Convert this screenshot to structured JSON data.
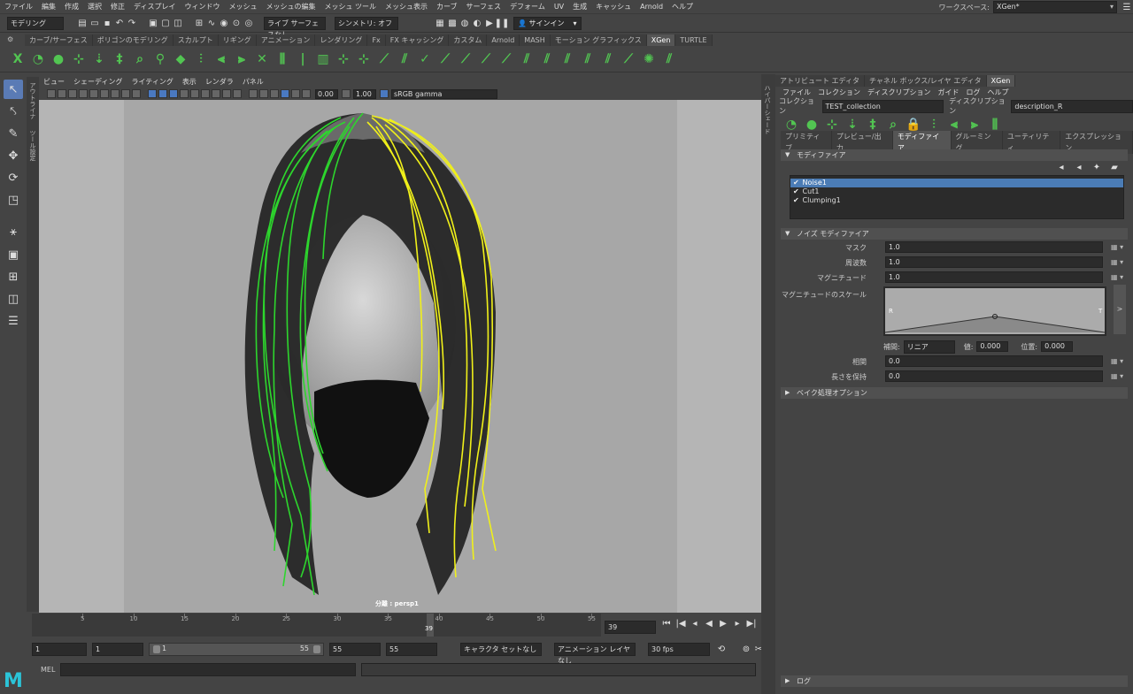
{
  "menubar": {
    "items": [
      "ファイル",
      "編集",
      "作成",
      "選択",
      "修正",
      "ディスプレイ",
      "ウィンドウ",
      "メッシュ",
      "メッシュの編集",
      "メッシュ ツール",
      "メッシュ表示",
      "カーブ",
      "サーフェス",
      "デフォーム",
      "UV",
      "生成",
      "キャッシュ",
      "Arnold",
      "ヘルプ"
    ],
    "workspace_label": "ワークスペース:",
    "workspace_value": "XGen*"
  },
  "status": {
    "mode": "モデリング",
    "live_surface": "ライブ サーフェスなし",
    "symmetry": "シンメトリ: オフ",
    "signin": "サインイン"
  },
  "shelf": {
    "tabs": [
      "カーブ/サーフェス",
      "ポリゴンのモデリング",
      "スカルプト",
      "リギング",
      "アニメーション",
      "レンダリング",
      "Fx",
      "FX キャッシング",
      "カスタム",
      "Arnold",
      "MASH",
      "モーション グラフィックス",
      "XGen",
      "TURTLE"
    ],
    "active": "XGen"
  },
  "toolbox": {
    "side_labels": [
      "アウトライナ",
      "ツール設定"
    ]
  },
  "panel": {
    "menu": [
      "ビュー",
      "シェーディング",
      "ライティング",
      "表示",
      "レンダラ",
      "パネル"
    ],
    "val1": "0.00",
    "val2": "1.00",
    "colorspace": "sRGB gamma",
    "camera": "分離 : persp1"
  },
  "timeline": {
    "ticks": [
      "5",
      "10",
      "15",
      "20",
      "25",
      "30",
      "35",
      "40",
      "45",
      "50",
      "55"
    ],
    "current": "39",
    "current_field": "39"
  },
  "range": {
    "start": "1",
    "start2": "1",
    "slider_start": "1",
    "slider_end": "55",
    "end": "55",
    "end2": "55",
    "char_set": "キャラクタ セットなし",
    "anim_layer": "アニメーション レイヤなし",
    "fps": "30 fps"
  },
  "cmd": {
    "label": "MEL"
  },
  "right": {
    "side_label": "ハイパーシェード",
    "tabs": [
      "アトリビュート エディタ",
      "チャネル ボックス/レイヤ エディタ",
      "XGen"
    ],
    "active_tab": "XGen",
    "menu": [
      "ファイル",
      "コレクション",
      "ディスクリプション",
      "ガイド",
      "ログ",
      "ヘルプ"
    ],
    "collection_label": "コレクション",
    "collection_value": "TEST_collection",
    "description_label": "ディスクリプション",
    "description_value": "description_R",
    "subtabs": [
      "プリミティブ",
      "プレビュー/出力",
      "モディファイア",
      "グルーミング",
      "ユーティリティ",
      "エクスプレッション"
    ],
    "active_subtab": "モディファイア",
    "modifier_section": "モディファイア",
    "modifiers": [
      "Noise1",
      "Cut1",
      "Clumping1"
    ],
    "noise_section": "ノイズ モディファイア",
    "props": [
      {
        "label": "マスク",
        "value": "1.0"
      },
      {
        "label": "周波数",
        "value": "1.0"
      },
      {
        "label": "マグニチュード",
        "value": "1.0"
      }
    ],
    "curve_label": "マグニチュードのスケール",
    "curve_r": "R",
    "curve_t": "T",
    "interp_label": "補間:",
    "interp_value": "リニア",
    "value_label": "値:",
    "value_value": "0.000",
    "pos_label": "位置:",
    "pos_value": "0.000",
    "props2": [
      {
        "label": "相関",
        "value": "0.0"
      },
      {
        "label": "長さを保持",
        "value": "0.0"
      }
    ],
    "bake_section": "ベイク処理オプション",
    "log_section": "ログ"
  }
}
